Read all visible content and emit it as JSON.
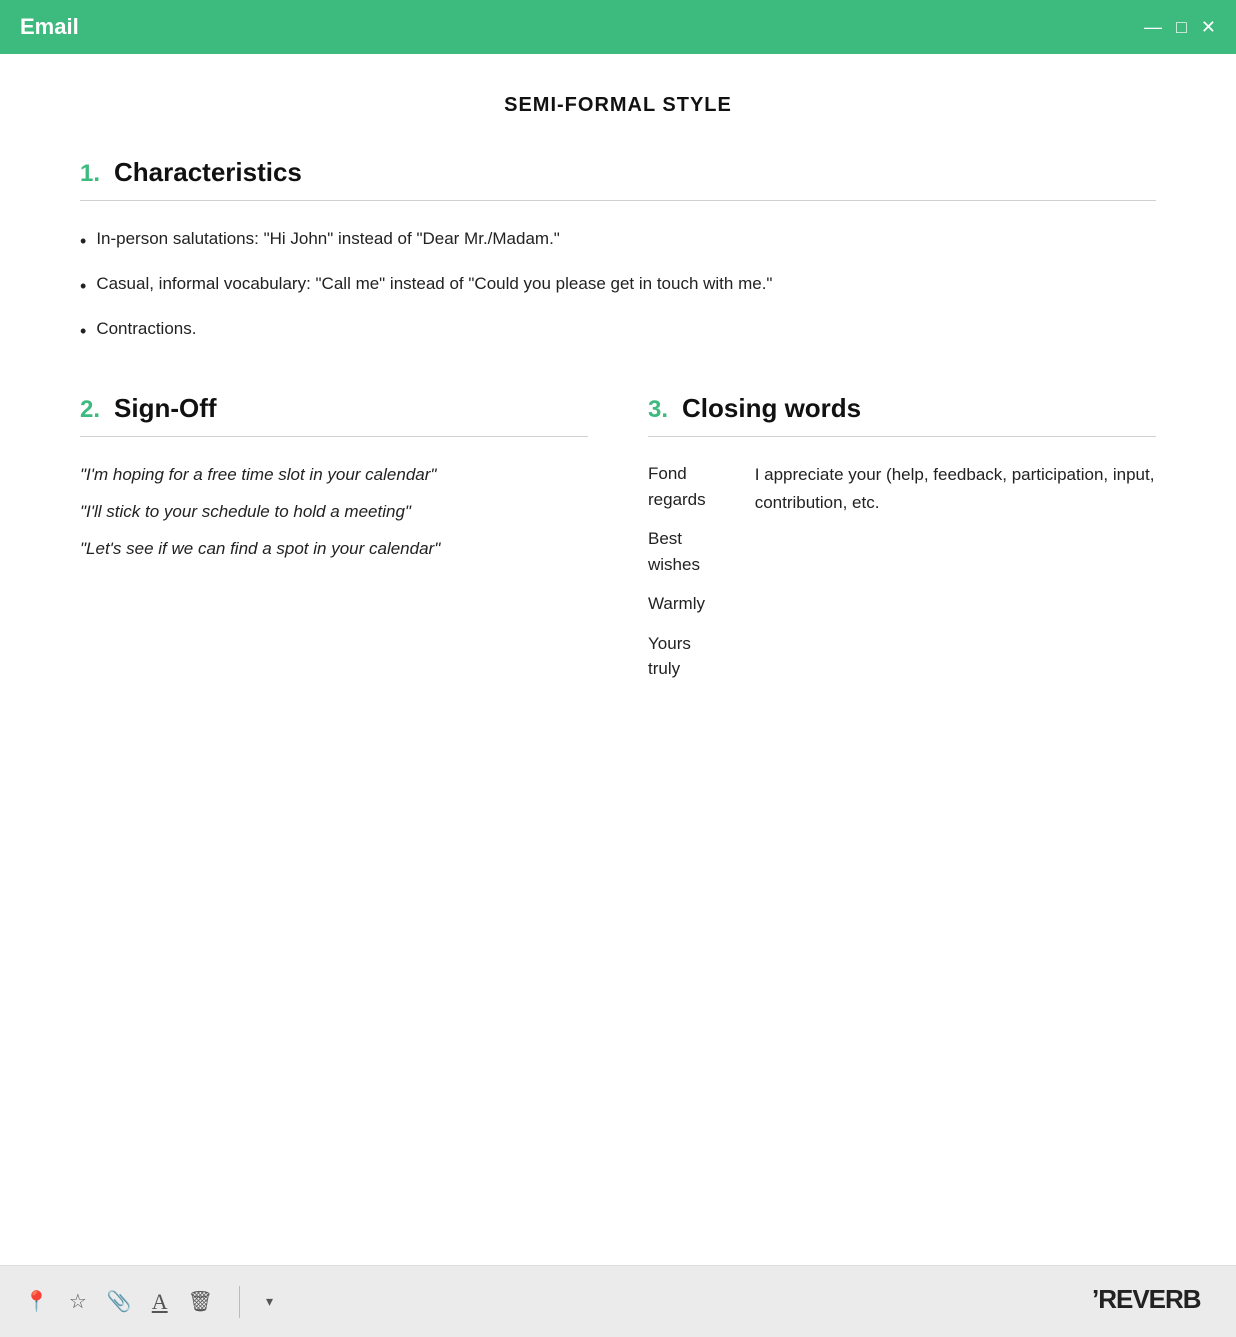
{
  "titlebar": {
    "title": "Email",
    "controls": {
      "minimize": "—",
      "maximize": "□",
      "close": "✕"
    }
  },
  "page": {
    "heading": "SEMI-FORMAL STYLE"
  },
  "section1": {
    "number": "1.",
    "title": "Characteristics",
    "bullets": [
      "In-person salutations: \"Hi John\" instead of \"Dear Mr./Madam.\"",
      "Casual, informal vocabulary: \"Call me\" instead of \"Could you please get in touch with me.\"",
      "Contractions."
    ]
  },
  "section2": {
    "number": "2.",
    "title": "Sign-Off",
    "lines": [
      "\"I'm hoping for a free time slot in your calendar\"",
      "\"I'll stick to your schedule to hold a meeting\"",
      "\"Let's see if we can find a spot in your calendar\""
    ]
  },
  "section3": {
    "number": "3.",
    "title": "Closing words",
    "words": [
      "Fond regards",
      "Best wishes",
      "Warmly",
      "Yours truly"
    ],
    "description": "I appreciate your (help, feedback, participation, input, contribution, etc."
  },
  "toolbar": {
    "icons": [
      "📍",
      "☆",
      "📎",
      "A",
      "🗑"
    ],
    "dropdown": "▾",
    "logo": "REVERB"
  }
}
